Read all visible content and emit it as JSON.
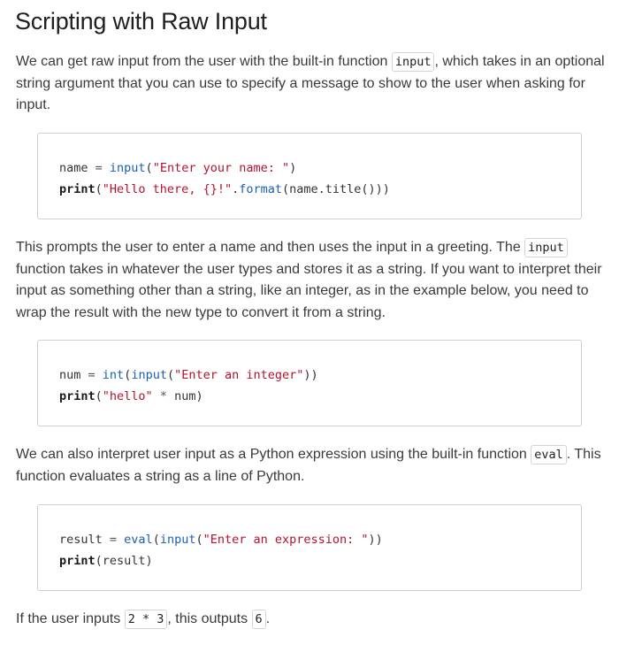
{
  "title": "Scripting with Raw Input",
  "p1": {
    "before": "We can get raw input from the user with the built-in function ",
    "code": "input",
    "after": ", which takes in an optional string argument that you can use to specify a message to show to the user when asking for input."
  },
  "code1": {
    "line1": {
      "var": "name",
      "op": " = ",
      "fn": "input",
      "open": "(",
      "str": "\"Enter your name: \"",
      "close": ")"
    },
    "line2": {
      "kw": "print",
      "open": "(",
      "str": "\"Hello there, {}!\"",
      "dot": ".",
      "method": "format",
      "rest": "(name.title()))"
    }
  },
  "p2": {
    "before": "This prompts the user to enter a name and then uses the input in a greeting. The ",
    "code": "input",
    "after": " function takes in whatever the user types and stores it as a string. If you want to interpret their input as something other than a string, like an integer, as in the example below, you need to wrap the result with the new type to convert it from a string."
  },
  "code2": {
    "line1": {
      "var": "num",
      "op": " = ",
      "fn1": "int",
      "open1": "(",
      "fn2": "input",
      "open2": "(",
      "str": "\"Enter an integer\"",
      "close": "))"
    },
    "line2": {
      "kw": "print",
      "open": "(",
      "str": "\"hello\"",
      "op": " * ",
      "rest": "num)"
    }
  },
  "p3": {
    "before": "We can also interpret user input as a Python expression using the built-in function ",
    "code": "eval",
    "after": ". This function evaluates a string as a line of Python."
  },
  "code3": {
    "line1": {
      "var": "result",
      "op": " = ",
      "fn1": "eval",
      "open1": "(",
      "fn2": "input",
      "open2": "(",
      "str": "\"Enter an expression: \"",
      "close": "))"
    },
    "line2": {
      "kw": "print",
      "rest": "(result)"
    }
  },
  "p4": {
    "before": "If the user inputs ",
    "code1": "2 * 3",
    "middle": ", this outputs ",
    "code2": "6",
    "after": "."
  }
}
